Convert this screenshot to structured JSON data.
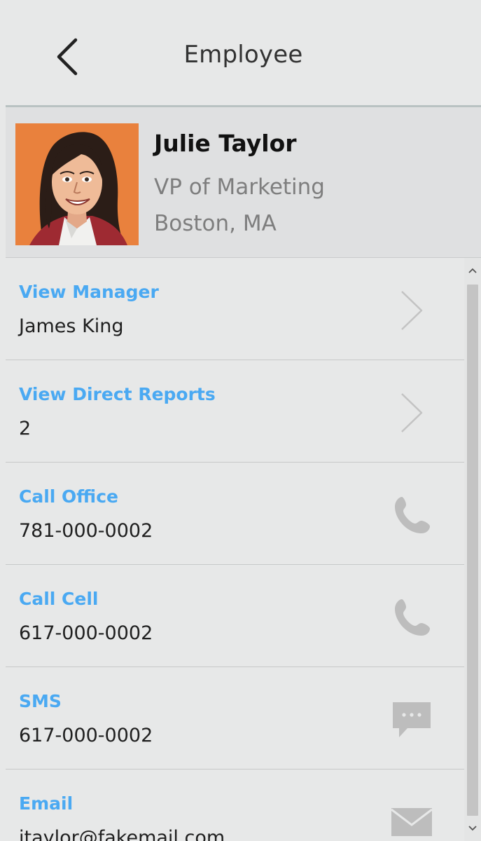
{
  "header": {
    "title": "Employee"
  },
  "profile": {
    "name": "Julie Taylor",
    "title": "VP of Marketing",
    "location": "Boston, MA"
  },
  "actions": [
    {
      "label": "View Manager",
      "value": "James King",
      "icon": "chevron-right-icon"
    },
    {
      "label": "View Direct Reports",
      "value": "2",
      "icon": "chevron-right-icon"
    },
    {
      "label": "Call Office",
      "value": "781-000-0002",
      "icon": "phone-icon"
    },
    {
      "label": "Call Cell",
      "value": "617-000-0002",
      "icon": "phone-icon"
    },
    {
      "label": "SMS",
      "value": "617-000-0002",
      "icon": "chat-bubble-icon"
    },
    {
      "label": "Email",
      "value": "jtaylor@fakemail.com",
      "icon": "envelope-icon"
    }
  ],
  "colors": {
    "accent": "#4aa9f2",
    "background": "#e7e8e8",
    "profile_background": "#dfe0e1",
    "icon_gray": "#bdbdbd"
  }
}
